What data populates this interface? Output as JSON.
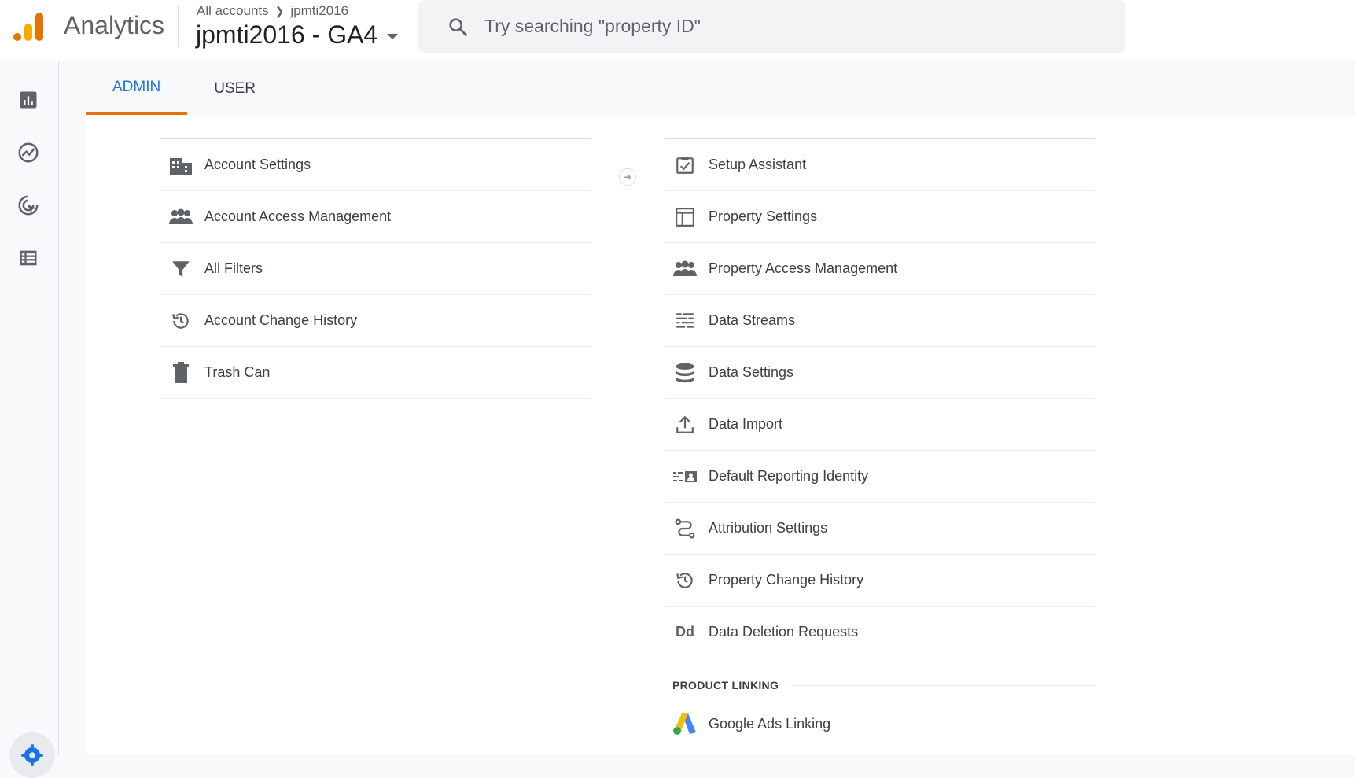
{
  "header": {
    "brand": "Analytics",
    "breadcrumb": [
      "All accounts",
      "jpmti2016"
    ],
    "property": "jpmti2016 - GA4",
    "search_placeholder": "Try searching \"property ID\""
  },
  "leftnav": [
    "reports-icon",
    "explore-icon",
    "advertising-icon",
    "configure-icon",
    "admin-gear-icon"
  ],
  "tabs": [
    {
      "label": "ADMIN",
      "active": true
    },
    {
      "label": "USER",
      "active": false
    }
  ],
  "account_items": [
    {
      "label": "Account Settings",
      "icon": "building-icon"
    },
    {
      "label": "Account Access Management",
      "icon": "people-icon"
    },
    {
      "label": "All Filters",
      "icon": "filter-icon"
    },
    {
      "label": "Account Change History",
      "icon": "history-icon"
    },
    {
      "label": "Trash Can",
      "icon": "trash-icon"
    }
  ],
  "property_items": [
    {
      "label": "Setup Assistant",
      "icon": "checkbox-icon"
    },
    {
      "label": "Property Settings",
      "icon": "layout-icon"
    },
    {
      "label": "Property Access Management",
      "icon": "people-icon"
    },
    {
      "label": "Data Streams",
      "icon": "streams-icon"
    },
    {
      "label": "Data Settings",
      "icon": "database-icon"
    },
    {
      "label": "Data Import",
      "icon": "upload-icon"
    },
    {
      "label": "Default Reporting Identity",
      "icon": "identity-icon"
    },
    {
      "label": "Attribution Settings",
      "icon": "attribution-icon"
    },
    {
      "label": "Property Change History",
      "icon": "history-icon"
    },
    {
      "label": "Data Deletion Requests",
      "icon": "data-deletion-icon"
    }
  ],
  "product_linking": {
    "title": "PRODUCT LINKING",
    "items": [
      {
        "label": "Google Ads Linking",
        "icon": "google-ads-icon"
      }
    ]
  },
  "icon_text": {
    "data_deletion": "Dd"
  },
  "colors": {
    "accent": "#1a73e8",
    "tab_indicator": "#e8710a",
    "logo_orange": "#f9ab00",
    "logo_dark": "#e37400"
  }
}
